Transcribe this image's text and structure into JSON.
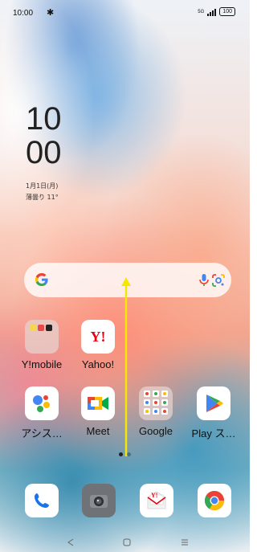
{
  "status_bar": {
    "time": "10:00",
    "network": "5G",
    "battery": "100"
  },
  "clock": {
    "hour": "10",
    "minute": "00",
    "date": "1月1日(月)",
    "weather": "薄曇り 11°"
  },
  "apps": [
    {
      "label": "Y!mobile",
      "icon": "folder-icon"
    },
    {
      "label": "Yahoo!",
      "icon": "yahoo-icon",
      "glyph": "Y!"
    },
    {
      "label": "アシス…",
      "icon": "google-assistant-icon"
    },
    {
      "label": "Meet",
      "icon": "google-meet-icon"
    },
    {
      "label": "Google",
      "icon": "folder-icon"
    },
    {
      "label": "Play ス…",
      "icon": "play-store-icon"
    }
  ],
  "dock": [
    {
      "icon": "phone-icon"
    },
    {
      "icon": "camera-icon"
    },
    {
      "icon": "yahoo-mail-icon",
      "glyph": "Y!"
    },
    {
      "icon": "chrome-icon"
    }
  ],
  "colors": {
    "google_blue": "#4285F4",
    "google_red": "#EA4335",
    "google_yellow": "#FBBC05",
    "google_green": "#34A853",
    "yahoo_red": "#E60012",
    "swipe_arrow": "#F7E600"
  }
}
